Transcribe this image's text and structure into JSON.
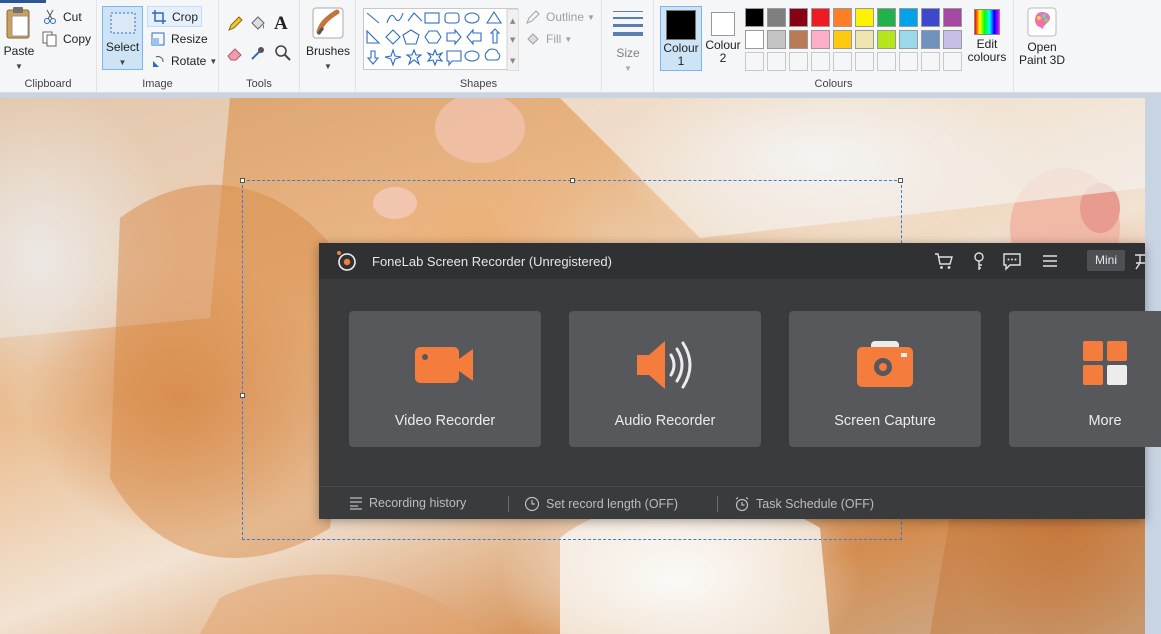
{
  "ribbon": {
    "clipboard": {
      "paste": "Paste",
      "cut": "Cut",
      "copy": "Copy",
      "group": "Clipboard"
    },
    "image": {
      "select": "Select",
      "crop": "Crop",
      "resize": "Resize",
      "rotate": "Rotate",
      "group": "Image"
    },
    "tools": {
      "group": "Tools"
    },
    "brushes": {
      "label": "Brushes"
    },
    "shapes": {
      "outline": "Outline",
      "fill": "Fill",
      "group": "Shapes"
    },
    "size": {
      "label": "Size"
    },
    "colours": {
      "colour1_line1": "Colour",
      "colour1_line2": "1",
      "colour2_line1": "Colour",
      "colour2_line2": "2",
      "edit_line1": "Edit",
      "edit_line2": "colours",
      "group": "Colours",
      "colour1_value": "#000000",
      "colour2_value": "#ffffff",
      "palette_row1": [
        "#000000",
        "#7f7f7f",
        "#880015",
        "#ed1c24",
        "#ff7f27",
        "#fff200",
        "#22b14c",
        "#00a2e8",
        "#3f48cc",
        "#a349a4"
      ],
      "palette_row2": [
        "#ffffff",
        "#c3c3c3",
        "#b97a57",
        "#ffaec9",
        "#ffc90e",
        "#efe4b0",
        "#b5e61d",
        "#99d9ea",
        "#7092be",
        "#c8bfe7"
      ]
    },
    "paint3d": {
      "line1": "Open",
      "line2": "Paint 3D"
    }
  },
  "fonelab": {
    "title": "FoneLab Screen Recorder (Unregistered)",
    "mini": "Mini",
    "cards": [
      {
        "label": "Video Recorder",
        "icon": "video-camera-icon"
      },
      {
        "label": "Audio Recorder",
        "icon": "speaker-icon"
      },
      {
        "label": "Screen Capture",
        "icon": "camera-icon"
      },
      {
        "label": "More",
        "icon": "grid-icon"
      }
    ],
    "bottom": {
      "history": "Recording history",
      "length": "Set record length (OFF)",
      "schedule": "Task Schedule (OFF)"
    },
    "accent": "#f47c3c"
  }
}
